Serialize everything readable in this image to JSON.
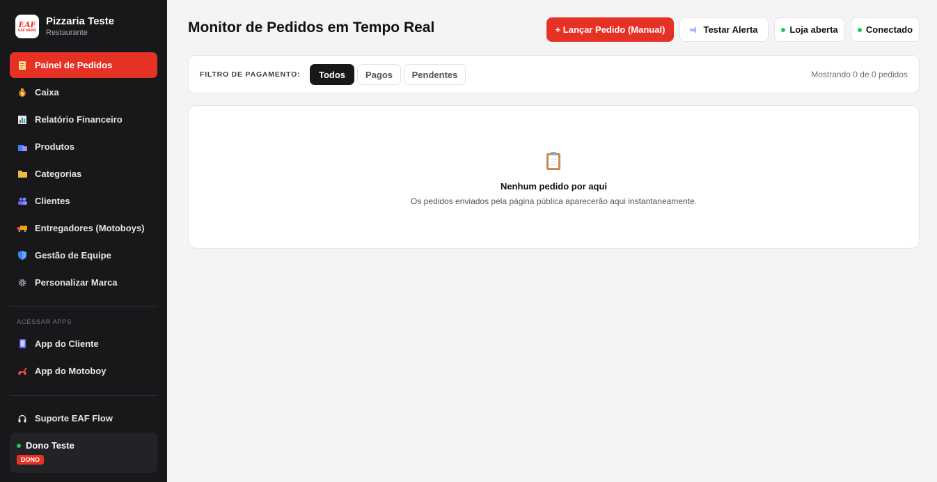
{
  "brand": {
    "name": "Pizzaria Teste",
    "subtitle": "Restaurante",
    "logo_line1": "EAF",
    "logo_line2": "EAF MENU"
  },
  "sidebar": {
    "items": [
      {
        "label": "Painel de Pedidos",
        "icon": "clipboard-icon",
        "active": true
      },
      {
        "label": "Caixa",
        "icon": "money-bag-icon"
      },
      {
        "label": "Relatório Financeiro",
        "icon": "bar-chart-icon"
      },
      {
        "label": "Produtos",
        "icon": "shopping-bags-icon"
      },
      {
        "label": "Categorias",
        "icon": "folder-icon"
      },
      {
        "label": "Clientes",
        "icon": "users-icon"
      },
      {
        "label": "Entregadores (Motoboys)",
        "icon": "delivery-truck-icon"
      },
      {
        "label": "Gestão de Equipe",
        "icon": "shield-icon"
      },
      {
        "label": "Personalizar Marca",
        "icon": "gear-icon"
      }
    ],
    "apps_title": "ACESSAR APPS",
    "apps": [
      {
        "label": "App do Cliente",
        "icon": "phone-icon"
      },
      {
        "label": "App do Motoboy",
        "icon": "scooter-icon"
      }
    ],
    "support_label": "Suporte EAF Flow",
    "user": {
      "name": "Dono Teste",
      "role": "DONO"
    }
  },
  "header": {
    "title": "Monitor de Pedidos em Tempo Real",
    "launch_button": "+ Lançar Pedido (Manual)",
    "test_alert_button": "Testar Alerta",
    "store_status": "Loja aberta",
    "connection_status": "Conectado"
  },
  "filter": {
    "label": "FILTRO DE PAGAMENTO:",
    "options": [
      "Todos",
      "Pagos",
      "Pendentes"
    ],
    "selected": "Todos",
    "showing_text": "Mostrando 0 de 0 pedidos"
  },
  "empty_state": {
    "title": "Nenhum pedido por aqui",
    "subtitle": "Os pedidos enviados pela página pública aparecerão aqui instantaneamente."
  },
  "colors": {
    "accent": "#e53225",
    "sidebar_bg": "#18181b",
    "status_green": "#22c55e"
  }
}
